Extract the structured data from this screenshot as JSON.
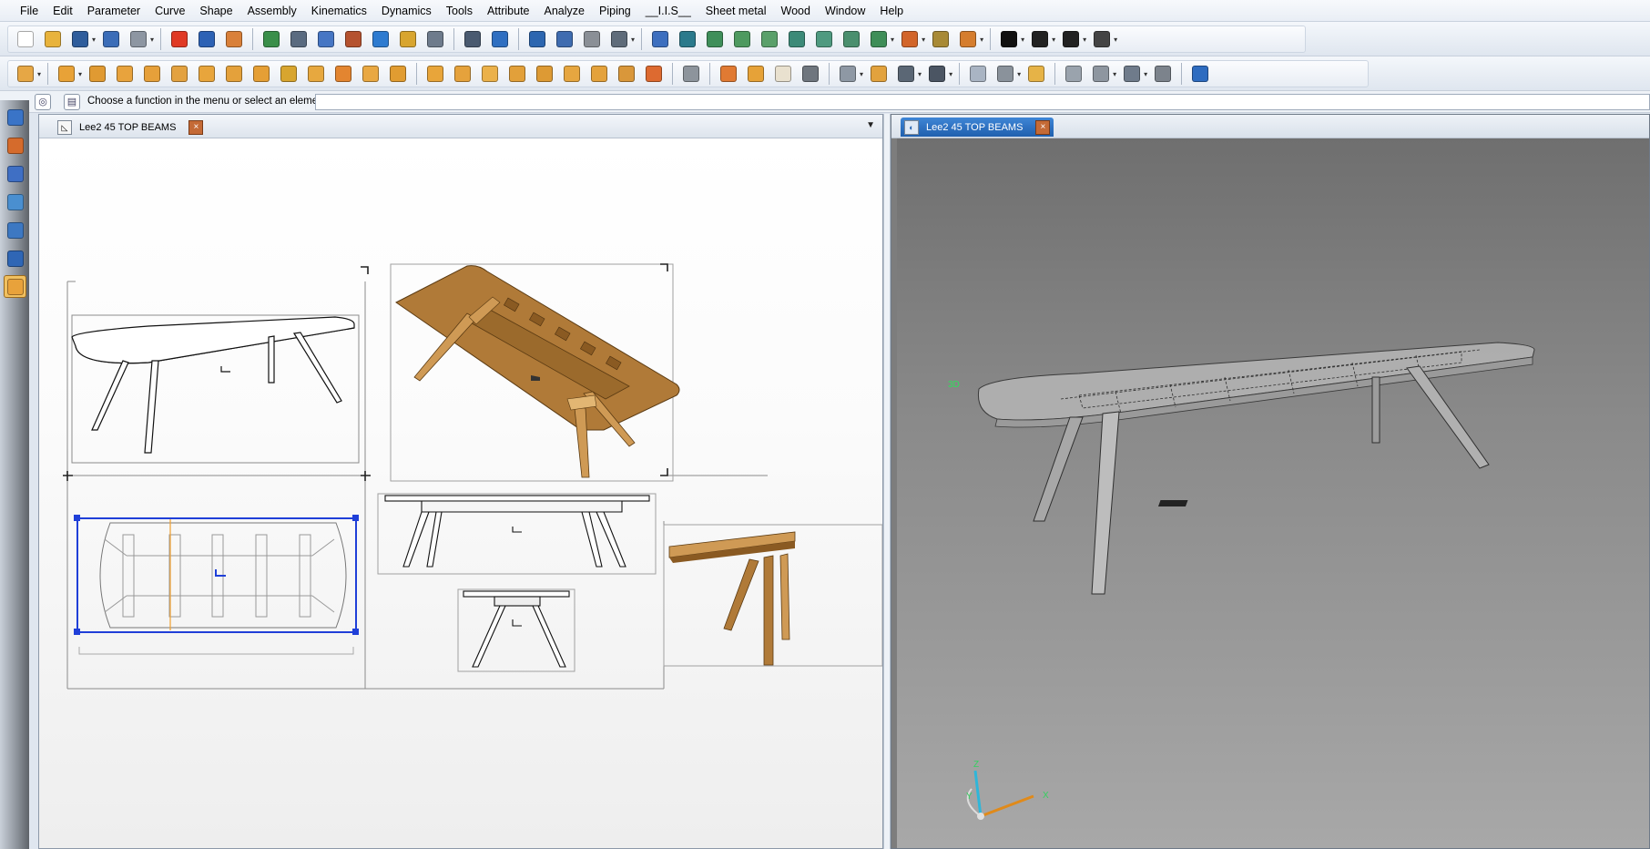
{
  "menu": [
    "File",
    "Edit",
    "Parameter",
    "Curve",
    "Shape",
    "Assembly",
    "Kinematics",
    "Dynamics",
    "Tools",
    "Attribute",
    "Analyze",
    "Piping",
    "__I.I.S__",
    "Sheet metal",
    "Wood",
    "Window",
    "Help"
  ],
  "toolbar1": {
    "icons": [
      {
        "name": "new-file-icon",
        "color": "#ffffff"
      },
      {
        "name": "open-folder-icon",
        "color": "#e8b33c"
      },
      {
        "name": "save-icon",
        "color": "#2f5d9c"
      },
      {
        "name": "info-icon",
        "color": "#3b6db8"
      },
      {
        "name": "print-icon",
        "color": "#8d96a2"
      },
      {
        "name": "delete-icon",
        "color": "#e03a25"
      },
      {
        "name": "undo-icon",
        "color": "#2d62b5"
      },
      {
        "name": "eraser-icon",
        "color": "#d9803a"
      },
      {
        "name": "regenerate-icon",
        "color": "#3a8f4a"
      },
      {
        "name": "zoom-dynamic-icon",
        "color": "#5a6b80"
      },
      {
        "name": "parameters-icon",
        "color": "#4676c4"
      },
      {
        "name": "hammer-icon",
        "color": "#b5522f"
      },
      {
        "name": "constraints-icon",
        "color": "#2e7bd0"
      },
      {
        "name": "magic-wand-icon",
        "color": "#d8a52f"
      },
      {
        "name": "measure-icon",
        "color": "#6e7b8c"
      },
      {
        "name": "tools-icon",
        "color": "#4a5a70"
      },
      {
        "name": "snap-icon",
        "color": "#2f6fc1"
      },
      {
        "name": "trim-icon",
        "color": "#2c66b0"
      },
      {
        "name": "sliders-icon",
        "color": "#3f6cb0"
      },
      {
        "name": "pipe-icon",
        "color": "#8a8f96"
      },
      {
        "name": "brush-icon",
        "color": "#5f6c7a"
      },
      {
        "name": "zoom-icon",
        "color": "#3d6fbf"
      },
      {
        "name": "zoom-fit-icon",
        "color": "#2b7a8c"
      },
      {
        "name": "view-front-icon",
        "color": "#3f8f5a"
      },
      {
        "name": "view-top-icon",
        "color": "#4e9a60"
      },
      {
        "name": "view-right-icon",
        "color": "#5aa06a"
      },
      {
        "name": "view-left-icon",
        "color": "#3c8a78"
      },
      {
        "name": "view-bottom-icon",
        "color": "#4f9a80"
      },
      {
        "name": "view-iso-icon",
        "color": "#4a8f6e"
      },
      {
        "name": "view-persp-icon",
        "color": "#3e8e58"
      },
      {
        "name": "render-mode-icon",
        "color": "#d2652a"
      },
      {
        "name": "light-icon",
        "color": "#a88a36"
      },
      {
        "name": "material-icon",
        "color": "#d57d2e"
      },
      {
        "name": "color-icon",
        "color": "#111111"
      },
      {
        "name": "point-style-icon",
        "color": "#222222"
      },
      {
        "name": "line-style-icon",
        "color": "#222222"
      },
      {
        "name": "hatch-style-icon",
        "color": "#444444"
      }
    ]
  },
  "toolbar2": {
    "icons": [
      {
        "name": "solid-sphere-icon",
        "color": "#e6a745"
      },
      {
        "name": "box-icon",
        "color": "#e8a237"
      },
      {
        "name": "wedge-icon",
        "color": "#e09a32"
      },
      {
        "name": "extrude-icon",
        "color": "#e8a33d"
      },
      {
        "name": "revolve-icon",
        "color": "#e6a03a"
      },
      {
        "name": "sweep-icon",
        "color": "#e3a240"
      },
      {
        "name": "loft-icon",
        "color": "#e8a53c"
      },
      {
        "name": "shell-icon",
        "color": "#e4a13b"
      },
      {
        "name": "drill-icon",
        "color": "#e59f35"
      },
      {
        "name": "pen-icon",
        "color": "#d8a52f"
      },
      {
        "name": "blend-icon",
        "color": "#e7a83f"
      },
      {
        "name": "chamfer-icon",
        "color": "#e38530"
      },
      {
        "name": "cut-icon",
        "color": "#e9a842"
      },
      {
        "name": "boolean-icon",
        "color": "#e19c31"
      },
      {
        "name": "wood-beam-icon",
        "color": "#e8a53a"
      },
      {
        "name": "wood-joint-icon",
        "color": "#e5a23c"
      },
      {
        "name": "wood-panel-icon",
        "color": "#ebb14a"
      },
      {
        "name": "wood-drill-icon",
        "color": "#e2a03a"
      },
      {
        "name": "wood-tenon-icon",
        "color": "#dd9a34"
      },
      {
        "name": "wood-mortise-icon",
        "color": "#e6a640"
      },
      {
        "name": "wood-dovetail-icon",
        "color": "#e4a23c"
      },
      {
        "name": "wood-hardware-icon",
        "color": "#d9973a"
      },
      {
        "name": "wood-cutlist-icon",
        "color": "#dd6a30"
      },
      {
        "name": "grey-tool-icon",
        "color": "#8d949c"
      },
      {
        "name": "wood-frame-icon",
        "color": "#e07a33"
      },
      {
        "name": "wood-corner-icon",
        "color": "#e6a238"
      },
      {
        "name": "wood-face-icon",
        "color": "#e9e1cf"
      },
      {
        "name": "wood-block-icon",
        "color": "#6f767e"
      },
      {
        "name": "sheet-fold-icon",
        "color": "#8e98a4"
      },
      {
        "name": "sheet-flange-icon",
        "color": "#e2a23d"
      },
      {
        "name": "sheet-unfold-icon",
        "color": "#5b6775"
      },
      {
        "name": "sheet-bend-icon",
        "color": "#4b5563"
      },
      {
        "name": "pattern-icon",
        "color": "#a9b4c3"
      },
      {
        "name": "mirror-icon",
        "color": "#8a929b"
      },
      {
        "name": "tag-icon",
        "color": "#e6b347"
      },
      {
        "name": "bom-icon",
        "color": "#9aa3ad"
      },
      {
        "name": "explode-icon",
        "color": "#8e96a0"
      },
      {
        "name": "assembly-tree-icon",
        "color": "#6f7b8b"
      },
      {
        "name": "grey-shape-icon",
        "color": "#7c838c"
      },
      {
        "name": "help-search-icon",
        "color": "#2e6cc0"
      }
    ]
  },
  "prompt": {
    "text": "Choose a function in the menu or select an element:",
    "input_value": ""
  },
  "left_tools": [
    {
      "name": "sketch-tool-icon",
      "color": "#3a74c7"
    },
    {
      "name": "curve-tool-icon",
      "color": "#d56b2c"
    },
    {
      "name": "solid-tool-icon",
      "color": "#3f6fc4"
    },
    {
      "name": "surface-tool-icon",
      "color": "#4a8fd0"
    },
    {
      "name": "assembly-tool-icon",
      "color": "#3d78c2"
    },
    {
      "name": "drawing-tool-icon",
      "color": "#2f66b5"
    },
    {
      "name": "wood-tool-icon",
      "color": "#e8a23b"
    }
  ],
  "drawing_window": {
    "tab_title": "Lee2 45 TOP BEAMS"
  },
  "model_window": {
    "tab_title": "Lee2 45 TOP BEAMS",
    "axis_labels": {
      "x": "X",
      "y": "Y",
      "z": "Z"
    }
  },
  "colors": {
    "wood": "#b07a38",
    "wood_dark": "#8a5a22",
    "wood_light": "#cf9a55",
    "selection": "#1f3fd8",
    "viewport_bg": "#8a8a8a"
  }
}
